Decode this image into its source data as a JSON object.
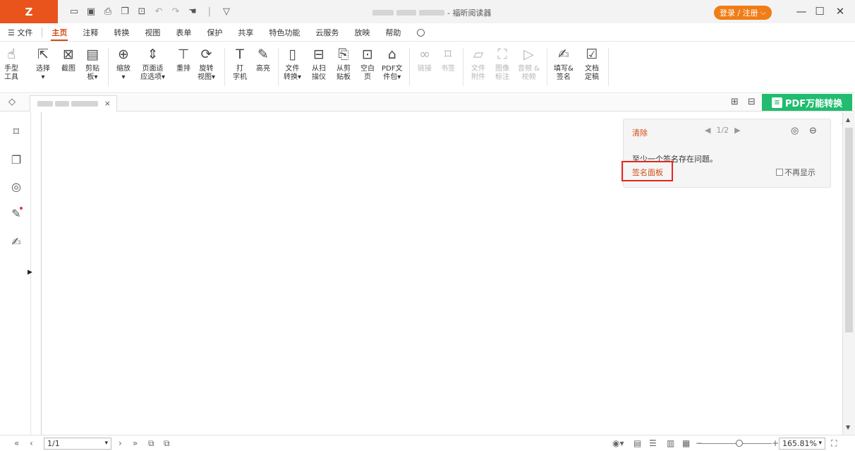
{
  "titlebar": {
    "logo": "Z",
    "doc_title_suffix": "- 福昕阅读器",
    "login_label": "登录 / 注册",
    "controls": {
      "minimize": "—",
      "maximize": "☐",
      "close": "✕"
    }
  },
  "quick_access": [
    "open-icon",
    "save-icon",
    "print-icon",
    "copy-icon",
    "new-icon",
    "undo-icon",
    "redo-icon",
    "hand-icon",
    "customize-icon"
  ],
  "menu": {
    "file": "☰ 文件",
    "tabs": [
      "主页",
      "注释",
      "转换",
      "视图",
      "表单",
      "保护",
      "共享",
      "特色功能",
      "云服务",
      "放映",
      "帮助"
    ],
    "active_tab": "主页"
  },
  "ribbon": {
    "hand": "手型\n工具",
    "select": "选择\n▾",
    "snapshot": "截图",
    "clipboard": "剪贴\n板▾",
    "zoom": "缩放\n▾",
    "page_fit": "页面适\n应选项▾",
    "reflow": "重排",
    "rotate": "旋转\n视图▾",
    "typewriter": "打\n字机",
    "highlight": "高亮",
    "convert": "文件\n转换▾",
    "scan": "从扫\n描仪",
    "from_clipboard": "从剪\n贴板",
    "blank": "空白\n页",
    "portfolio": "PDF文\n件包▾",
    "link": "链接",
    "bookmark": "书签",
    "attachment": "文件\n附件",
    "image": "图像\n标注",
    "media": "音频 &\n视频",
    "fill_sign": "填写&\n签名",
    "finalize": "文档\n定稿"
  },
  "tabstrip": {
    "doc_tab_close": "×",
    "pdf_convert_label": "PDF万能转换"
  },
  "signature_panel": {
    "clear": "清除",
    "pager": "1/2",
    "message": "至少一个签名存在问题。",
    "link": "签名面板",
    "checkbox_label": "不再显示"
  },
  "statusbar": {
    "page": "1/1",
    "zoom": "165.81%"
  },
  "colors": {
    "brand": "#e8541c",
    "accent_orange": "#f07d17",
    "active_tab": "#d44a14",
    "pdf_convert_green": "#20bc6f",
    "highlight_box": "#e52620"
  }
}
